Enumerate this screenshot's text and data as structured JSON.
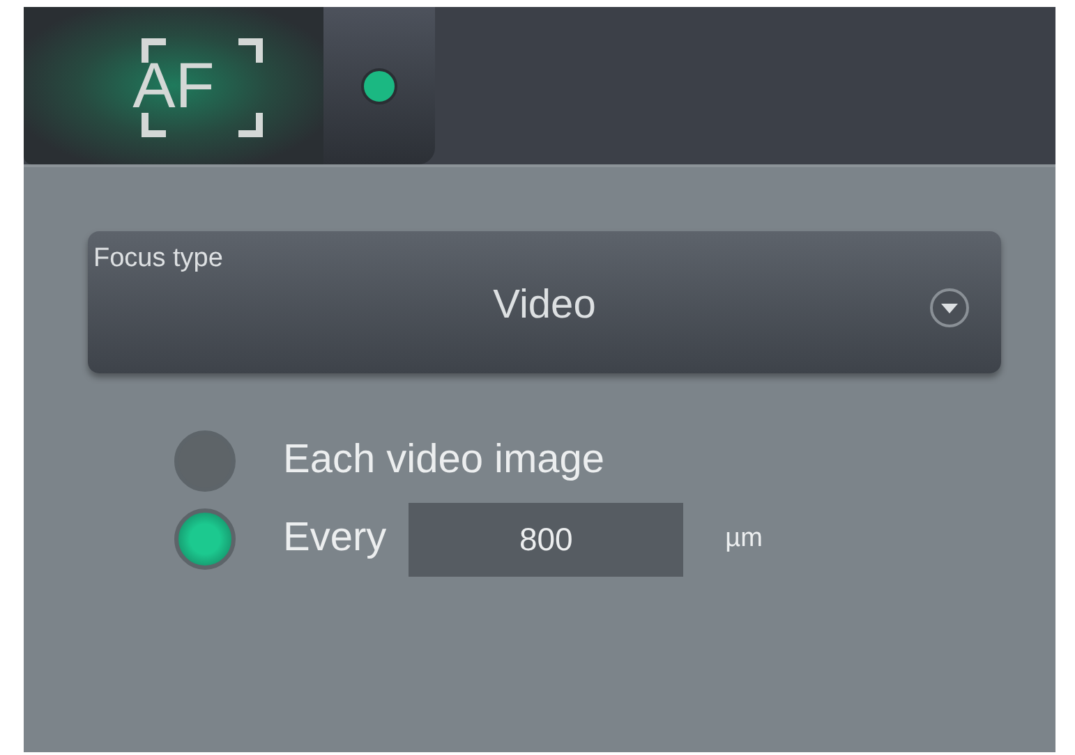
{
  "toolbar": {
    "autofocus_button": {
      "label": "AF"
    },
    "status_led": {
      "on": true
    }
  },
  "focus_type": {
    "label": "Focus type",
    "value": "Video"
  },
  "options": [
    {
      "kind": "plain",
      "label": "Each video image",
      "selected": false
    },
    {
      "kind": "interval",
      "label": "Every",
      "selected": true,
      "value": "800",
      "unit": "µm"
    }
  ]
}
